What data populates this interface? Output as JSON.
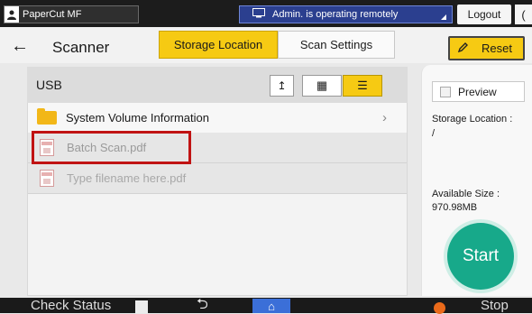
{
  "status_bar": {
    "user_label": "PaperCut MF",
    "user_icon": "user-icon",
    "remote_text": "Admin. is operating remotely",
    "remote_icon": "remote-screen-icon",
    "logout_label": "Logout",
    "extra_label": "("
  },
  "header": {
    "back_icon": "←",
    "title": "Scanner",
    "tabs": [
      {
        "label": "Storage Location",
        "active": true
      },
      {
        "label": "Scan Settings",
        "active": false
      }
    ],
    "reset_label": "Reset"
  },
  "file_panel": {
    "location": "USB",
    "view_buttons": {
      "up_icon": "↥",
      "grid_icon": "▦",
      "list_icon": "☰",
      "active_view": "list"
    },
    "items": [
      {
        "name": "System Volume Information",
        "type": "folder"
      },
      {
        "name": "Batch Scan.pdf",
        "type": "file"
      },
      {
        "name": "Type filename here.pdf",
        "type": "file"
      }
    ]
  },
  "side_panel": {
    "preview_label": "Preview",
    "storage_location_label": "Storage Location :",
    "storage_location_value": "/",
    "available_size_label": "Available Size :",
    "available_size_value": "970.98MB",
    "start_label": "Start"
  },
  "bottom_bar": {
    "check_status_label": "Check Status",
    "back_icon": "⮌",
    "home_icon": "⌂",
    "stop_label": "Stop"
  },
  "colors": {
    "accent_yellow": "#f6ca13",
    "start_green": "#17a98a",
    "highlight_red": "#c01313",
    "remote_blue": "#2b3f8f"
  }
}
